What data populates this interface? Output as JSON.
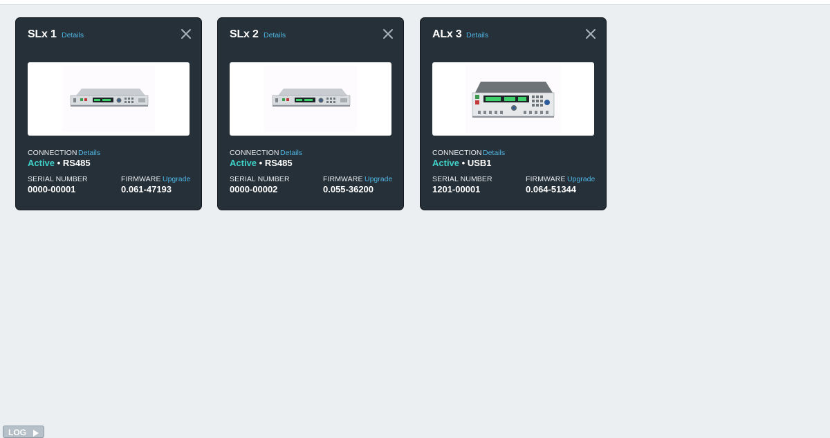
{
  "devices": [
    {
      "name": "SLx 1",
      "details_label": "Details",
      "connection_label": "CONNECTION",
      "connection_details_label": "Details",
      "status": "Active",
      "separator": "•",
      "interface": "RS485",
      "serial_label": "SERIAL NUMBER",
      "serial": "0000-00001",
      "firmware_label": "FIRMWARE",
      "upgrade_label": "Upgrade",
      "firmware": "0.061-47193",
      "image_icon": "rack-power-supply-1u"
    },
    {
      "name": "SLx 2",
      "details_label": "Details",
      "connection_label": "CONNECTION",
      "connection_details_label": "Details",
      "status": "Active",
      "separator": "•",
      "interface": "RS485",
      "serial_label": "SERIAL NUMBER",
      "serial": "0000-00002",
      "firmware_label": "FIRMWARE",
      "upgrade_label": "Upgrade",
      "firmware": "0.055-36200",
      "image_icon": "rack-power-supply-1u"
    },
    {
      "name": "ALx 3",
      "details_label": "Details",
      "connection_label": "CONNECTION",
      "connection_details_label": "Details",
      "status": "Active",
      "separator": "•",
      "interface": "USB1",
      "serial_label": "SERIAL NUMBER",
      "serial": "1201-00001",
      "firmware_label": "FIRMWARE",
      "upgrade_label": "Upgrade",
      "firmware": "0.064-51344",
      "image_icon": "rack-power-supply-3u"
    }
  ],
  "log_button": {
    "label": "LOG"
  },
  "colors": {
    "page_bg": "#ebeff2",
    "card_bg": "#263038",
    "link": "#4fb6e3",
    "active": "#3fd0c9"
  }
}
